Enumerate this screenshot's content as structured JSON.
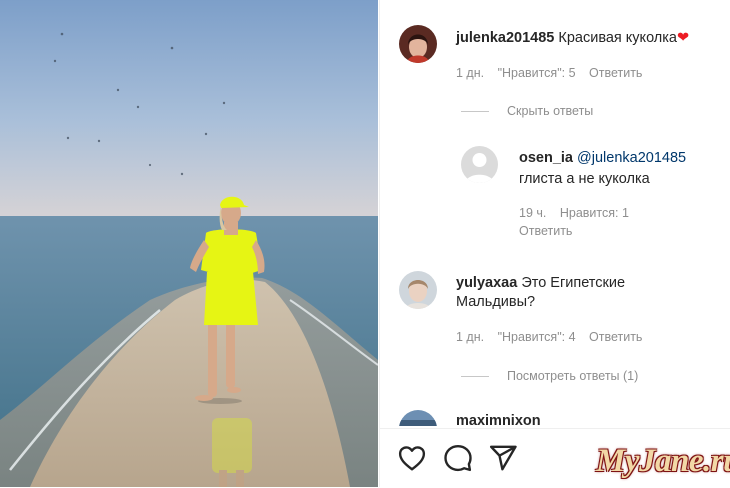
{
  "post": {
    "image_alt": "Woman in neon yellow outfit on a sand spit at the sea"
  },
  "comments": [
    {
      "username": "julenka201485",
      "text": "Красивая куколка",
      "emoji": "heart",
      "time": "1 дн.",
      "likes": "\"Нравится\": 5",
      "reply": "Ответить",
      "toggle": "Скрыть ответы",
      "replies": [
        {
          "username": "osen_ia",
          "mention": "@julenka201485",
          "text": "глиста а не куколка",
          "time": "19 ч.",
          "likes": "Нравится: 1",
          "reply": "Ответить"
        }
      ]
    },
    {
      "username": "yulyaxaa",
      "text_line1": "Это Египетские",
      "text_line2": "Мальдивы?",
      "time": "1 дн.",
      "likes": "\"Нравится\": 4",
      "reply": "Ответить",
      "toggle": "Посмотреть ответы (1)"
    },
    {
      "username": "maximnixon"
    }
  ],
  "actions": {
    "like_icon": "heart-icon",
    "comment_icon": "comment-icon",
    "share_icon": "share-icon"
  },
  "watermark": "MyJane.ru",
  "colors": {
    "link": "#00376b",
    "meta": "#8e8e8e",
    "outfit": "#e6f514"
  }
}
